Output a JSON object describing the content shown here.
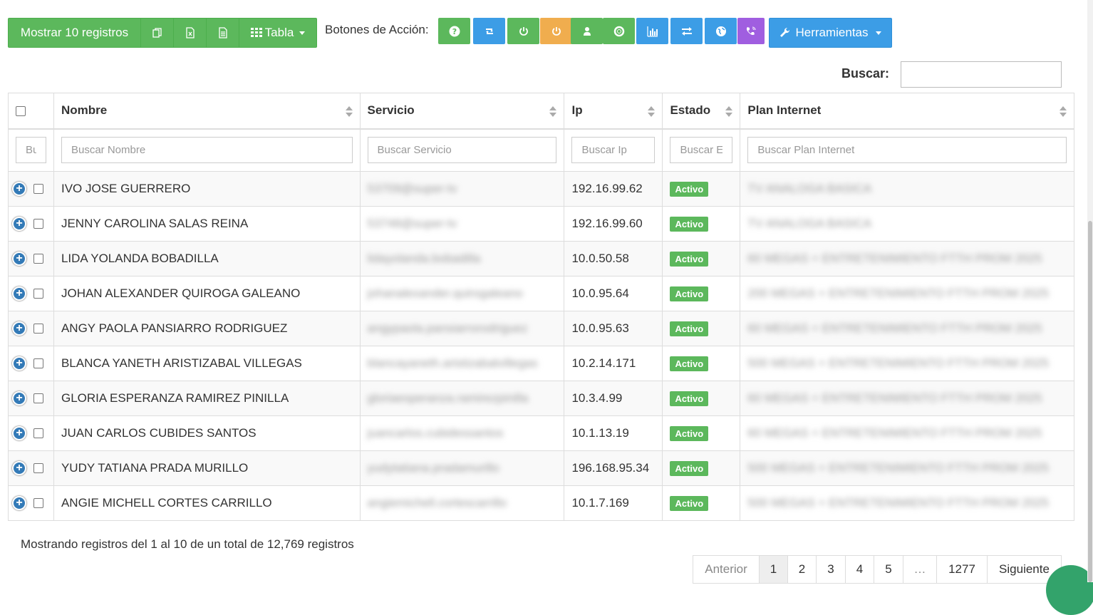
{
  "toolbar": {
    "show_records": "Mostrar 10 registros",
    "export_icons": [
      "copy-icon",
      "excel-icon",
      "csv-icon"
    ],
    "table_label": "Tabla",
    "actions_label": "Botones de Acción:",
    "tools_label": "Herramientas",
    "action_buttons": [
      {
        "icon": "question-icon",
        "color": "#5cb85c"
      },
      {
        "icon": "retweet-icon",
        "color": "#3c9de6"
      },
      {
        "icon": "power-icon",
        "color": "#5cb85c"
      },
      {
        "icon": "power-icon",
        "color": "#f0ad4e"
      },
      {
        "icon": "user-icon",
        "color": "#5cb85c"
      },
      {
        "icon": "lifebuoy-icon",
        "color": "#5cb85c"
      },
      {
        "icon": "bar-chart-icon",
        "color": "#3c9de6"
      },
      {
        "icon": "transfer-icon",
        "color": "#3c9de6"
      },
      {
        "icon": "globe-icon",
        "color": "#3c9de6"
      },
      {
        "icon": "phone-icon",
        "color": "#a05ee0"
      }
    ]
  },
  "search": {
    "label": "Buscar:",
    "value": ""
  },
  "table": {
    "columns": [
      "Nombre",
      "Servicio",
      "Ip",
      "Estado",
      "Plan Internet"
    ],
    "filters": [
      "Bu",
      "Buscar Nombre",
      "Buscar Servicio",
      "Buscar Ip",
      "Buscar E",
      "Buscar Plan Internet"
    ],
    "rows": [
      {
        "nombre": "IVO JOSE GUERRERO",
        "servicio": "53709@super-tv",
        "ip": "192.16.99.62",
        "estado": "Activo",
        "plan": "TV ANALOGA BASICA"
      },
      {
        "nombre": "JENNY CAROLINA SALAS REINA",
        "servicio": "53748@super-tv",
        "ip": "192.16.99.60",
        "estado": "Activo",
        "plan": "TV ANALOGA BASICA"
      },
      {
        "nombre": "LIDA YOLANDA BOBADILLA",
        "servicio": "lidayolanda.bobadilla",
        "ip": "10.0.50.58",
        "estado": "Activo",
        "plan": "60 MEGAS + ENTRETENIMIENTO FTTH PROM 2025"
      },
      {
        "nombre": "JOHAN ALEXANDER QUIROGA GALEANO",
        "servicio": "johanalexander.quirogaleano",
        "ip": "10.0.95.64",
        "estado": "Activo",
        "plan": "200 MEGAS + ENTRETENIMIENTO FTTH PROM 2025"
      },
      {
        "nombre": "ANGY PAOLA PANSIARRO RODRIGUEZ",
        "servicio": "angypaola.pansiarrorodriguez",
        "ip": "10.0.95.63",
        "estado": "Activo",
        "plan": "60 MEGAS + ENTRETENIMIENTO FTTH PROM 2025"
      },
      {
        "nombre": "BLANCA YANETH ARISTIZABAL VILLEGAS",
        "servicio": "blancayaneth.aristizabalvillegas",
        "ip": "10.2.14.171",
        "estado": "Activo",
        "plan": "500 MEGAS + ENTRETENIMIENTO FTTH PROM 2025"
      },
      {
        "nombre": "GLORIA ESPERANZA RAMIREZ PINILLA",
        "servicio": "gloriaesperanza.ramirezpinilla",
        "ip": "10.3.4.99",
        "estado": "Activo",
        "plan": "60 MEGAS + ENTRETENIMIENTO FTTH PROM 2025"
      },
      {
        "nombre": "JUAN CARLOS CUBIDES SANTOS",
        "servicio": "juancarlos.cubidessantos",
        "ip": "10.1.13.19",
        "estado": "Activo",
        "plan": "60 MEGAS + ENTRETENIMIENTO FTTH PROM 2025"
      },
      {
        "nombre": "YUDY TATIANA PRADA MURILLO",
        "servicio": "yudytatiana.pradamurillo",
        "ip": "196.168.95.34",
        "estado": "Activo",
        "plan": "500 MEGAS + ENTRETENIMIENTO FTTH PROM 2025"
      },
      {
        "nombre": "ANGIE MICHELL CORTES CARRILLO",
        "servicio": "angiemichell.cortescarrillo",
        "ip": "10.1.7.169",
        "estado": "Activo",
        "plan": "500 MEGAS + ENTRETENIMIENTO FTTH PROM 2025"
      }
    ]
  },
  "footer": {
    "info": "Mostrando registros del 1 al 10 de un total de 12,769 registros",
    "pagination": [
      "Anterior",
      "1",
      "2",
      "3",
      "4",
      "5",
      "…",
      "1277",
      "Siguiente"
    ],
    "active_page": "1"
  }
}
